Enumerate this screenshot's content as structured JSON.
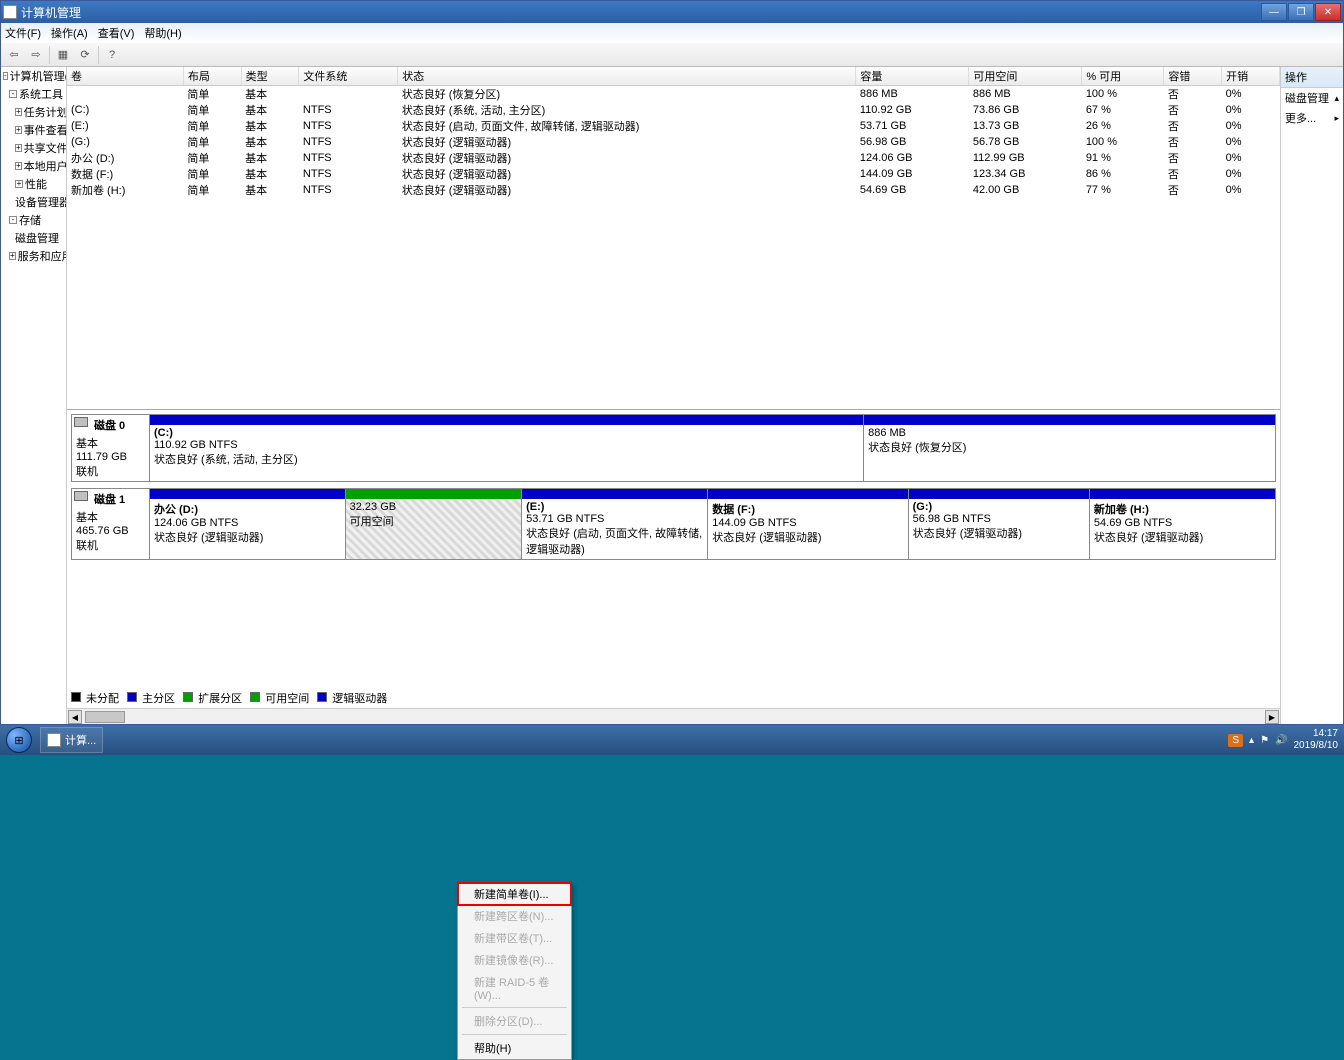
{
  "window": {
    "title": "计算机管理"
  },
  "winbuttons": {
    "min": "—",
    "max": "❐",
    "close": "✕"
  },
  "menu": {
    "file": "文件(F)",
    "action": "操作(A)",
    "view": "查看(V)",
    "help": "帮助(H)"
  },
  "sidebar": [
    {
      "label": "计算机管理(本",
      "level": 0,
      "toggle": "-"
    },
    {
      "label": "系统工具",
      "level": 1,
      "toggle": "-"
    },
    {
      "label": "任务计划程",
      "level": 2,
      "toggle": "+"
    },
    {
      "label": "事件查看器",
      "level": 2,
      "toggle": "+"
    },
    {
      "label": "共享文件夹",
      "level": 2,
      "toggle": "+"
    },
    {
      "label": "本地用户和",
      "level": 2,
      "toggle": "+"
    },
    {
      "label": "性能",
      "level": 2,
      "toggle": "+"
    },
    {
      "label": "设备管理器",
      "level": 2,
      "toggle": ""
    },
    {
      "label": "存储",
      "level": 1,
      "toggle": "-"
    },
    {
      "label": "磁盘管理",
      "level": 2,
      "toggle": ""
    },
    {
      "label": "服务和应用程",
      "level": 1,
      "toggle": "+"
    }
  ],
  "columns": [
    "卷",
    "布局",
    "类型",
    "文件系统",
    "状态",
    "容量",
    "可用空间",
    "% 可用",
    "容错",
    "开销"
  ],
  "volumes": [
    {
      "name": "",
      "layout": "简单",
      "type": "基本",
      "fs": "",
      "status": "状态良好 (恢复分区)",
      "cap": "886 MB",
      "free": "886 MB",
      "pct": "100 %",
      "fault": "否",
      "ovh": "0%"
    },
    {
      "name": "(C:)",
      "layout": "简单",
      "type": "基本",
      "fs": "NTFS",
      "status": "状态良好 (系统, 活动, 主分区)",
      "cap": "110.92 GB",
      "free": "73.86 GB",
      "pct": "67 %",
      "fault": "否",
      "ovh": "0%"
    },
    {
      "name": "(E:)",
      "layout": "简单",
      "type": "基本",
      "fs": "NTFS",
      "status": "状态良好 (启动, 页面文件, 故障转储, 逻辑驱动器)",
      "cap": "53.71 GB",
      "free": "13.73 GB",
      "pct": "26 %",
      "fault": "否",
      "ovh": "0%"
    },
    {
      "name": "(G:)",
      "layout": "简单",
      "type": "基本",
      "fs": "NTFS",
      "status": "状态良好 (逻辑驱动器)",
      "cap": "56.98 GB",
      "free": "56.78 GB",
      "pct": "100 %",
      "fault": "否",
      "ovh": "0%"
    },
    {
      "name": "办公 (D:)",
      "layout": "简单",
      "type": "基本",
      "fs": "NTFS",
      "status": "状态良好 (逻辑驱动器)",
      "cap": "124.06 GB",
      "free": "112.99 GB",
      "pct": "91 %",
      "fault": "否",
      "ovh": "0%"
    },
    {
      "name": "数据 (F:)",
      "layout": "简单",
      "type": "基本",
      "fs": "NTFS",
      "status": "状态良好 (逻辑驱动器)",
      "cap": "144.09 GB",
      "free": "123.34 GB",
      "pct": "86 %",
      "fault": "否",
      "ovh": "0%"
    },
    {
      "name": "新加卷 (H:)",
      "layout": "简单",
      "type": "基本",
      "fs": "NTFS",
      "status": "状态良好 (逻辑驱动器)",
      "cap": "54.69 GB",
      "free": "42.00 GB",
      "pct": "77 %",
      "fault": "否",
      "ovh": "0%"
    }
  ],
  "disk0": {
    "name": "磁盘 0",
    "type": "基本",
    "size": "111.79 GB",
    "state": "联机",
    "parts": [
      {
        "title": "(C:)",
        "line2": "110.92 GB NTFS",
        "line3": "状态良好 (系统, 活动, 主分区)",
        "head": "primary",
        "grow": 7
      },
      {
        "title": "",
        "line2": "886 MB",
        "line3": "状态良好 (恢复分区)",
        "head": "primary",
        "grow": 4
      }
    ]
  },
  "disk1": {
    "name": "磁盘 1",
    "type": "基本",
    "size": "465.76 GB",
    "state": "联机",
    "parts": [
      {
        "title": "办公  (D:)",
        "line2": "124.06 GB NTFS",
        "line3": "状态良好 (逻辑驱动器)",
        "head": "primary",
        "grow": 195
      },
      {
        "title": "",
        "line2": "32.23 GB",
        "line3": "可用空间",
        "head": "green",
        "grow": 175,
        "hatched": true
      },
      {
        "title": "(E:)",
        "line2": "53.71 GB NTFS",
        "line3": "状态良好 (启动, 页面文件, 故障转储, 逻辑驱动器)",
        "head": "primary",
        "grow": 185
      },
      {
        "title": "数据  (F:)",
        "line2": "144.09 GB NTFS",
        "line3": "状态良好 (逻辑驱动器)",
        "head": "primary",
        "grow": 200
      },
      {
        "title": "(G:)",
        "line2": "56.98 GB NTFS",
        "line3": "状态良好 (逻辑驱动器)",
        "head": "primary",
        "grow": 180
      },
      {
        "title": "新加卷  (H:)",
        "line2": "54.69 GB NTFS",
        "line3": "状态良好 (逻辑驱动器)",
        "head": "primary",
        "grow": 185
      }
    ]
  },
  "legend": [
    "未分配",
    "主分区",
    "扩展分区",
    "可用空间",
    "逻辑驱动器"
  ],
  "ctx": {
    "items": [
      {
        "label": "新建简单卷(I)...",
        "enabled": true,
        "highlight": true
      },
      {
        "label": "新建跨区卷(N)...",
        "enabled": false
      },
      {
        "label": "新建带区卷(T)...",
        "enabled": false
      },
      {
        "label": "新建镜像卷(R)...",
        "enabled": false
      },
      {
        "label": "新建 RAID-5 卷(W)...",
        "enabled": false
      },
      {
        "label": "删除分区(D)...",
        "enabled": false
      },
      {
        "label": "帮助(H)",
        "enabled": true
      }
    ]
  },
  "actions": {
    "header": "操作",
    "group": "磁盘管理",
    "more": "更多..."
  },
  "task": {
    "label": "计算..."
  },
  "tray": {
    "ime": "S",
    "time": "14:17",
    "date": "2019/8/10"
  }
}
